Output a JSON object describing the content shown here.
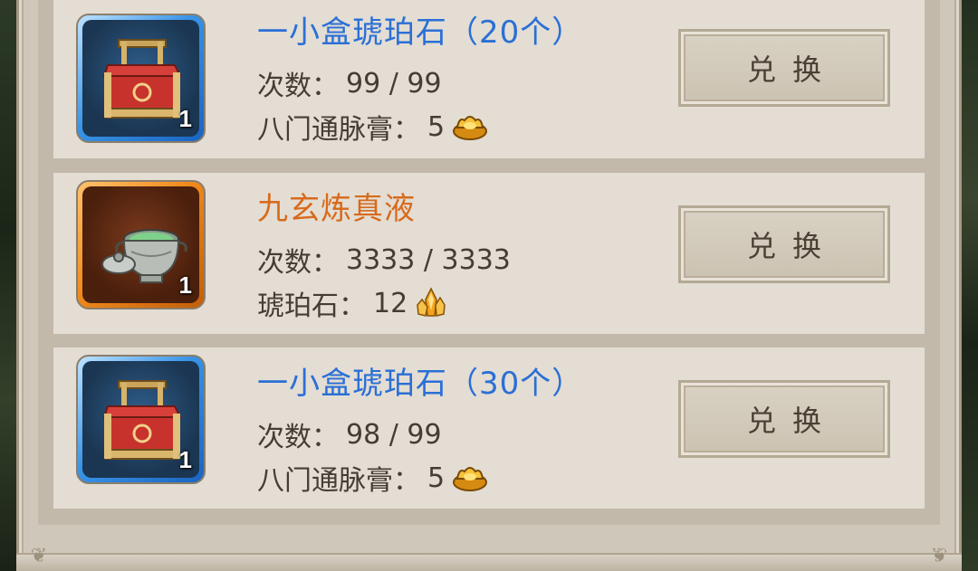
{
  "exchange_list": {
    "items": [
      {
        "name": "一小盒琥珀石（20个）",
        "name_color": "#2a6fd6",
        "quantity": "1",
        "count_label": "次数：",
        "count_value": "99 / 99",
        "cost_label": "八门通脉膏：",
        "cost_value": "5",
        "cost_icon": "gold-ingot-icon",
        "item_icon": "red-treasure-chest-icon",
        "frame_color": "blue",
        "button_label": "兑换"
      },
      {
        "name": "九玄炼真液",
        "name_color": "#d86a1c",
        "quantity": "1",
        "count_label": "次数：",
        "count_value": "3333 / 3333",
        "cost_label": "琥珀石：",
        "cost_value": "12",
        "cost_icon": "amber-crystal-icon",
        "item_icon": "silver-incense-burner-icon",
        "frame_color": "orange",
        "button_label": "兑换"
      },
      {
        "name": "一小盒琥珀石（30个）",
        "name_color": "#2a6fd6",
        "quantity": "1",
        "count_label": "次数：",
        "count_value": "98 / 99",
        "cost_label": "八门通脉膏：",
        "cost_value": "5",
        "cost_icon": "gold-ingot-icon",
        "item_icon": "red-treasure-chest-icon",
        "frame_color": "blue",
        "button_label": "兑换"
      }
    ]
  }
}
